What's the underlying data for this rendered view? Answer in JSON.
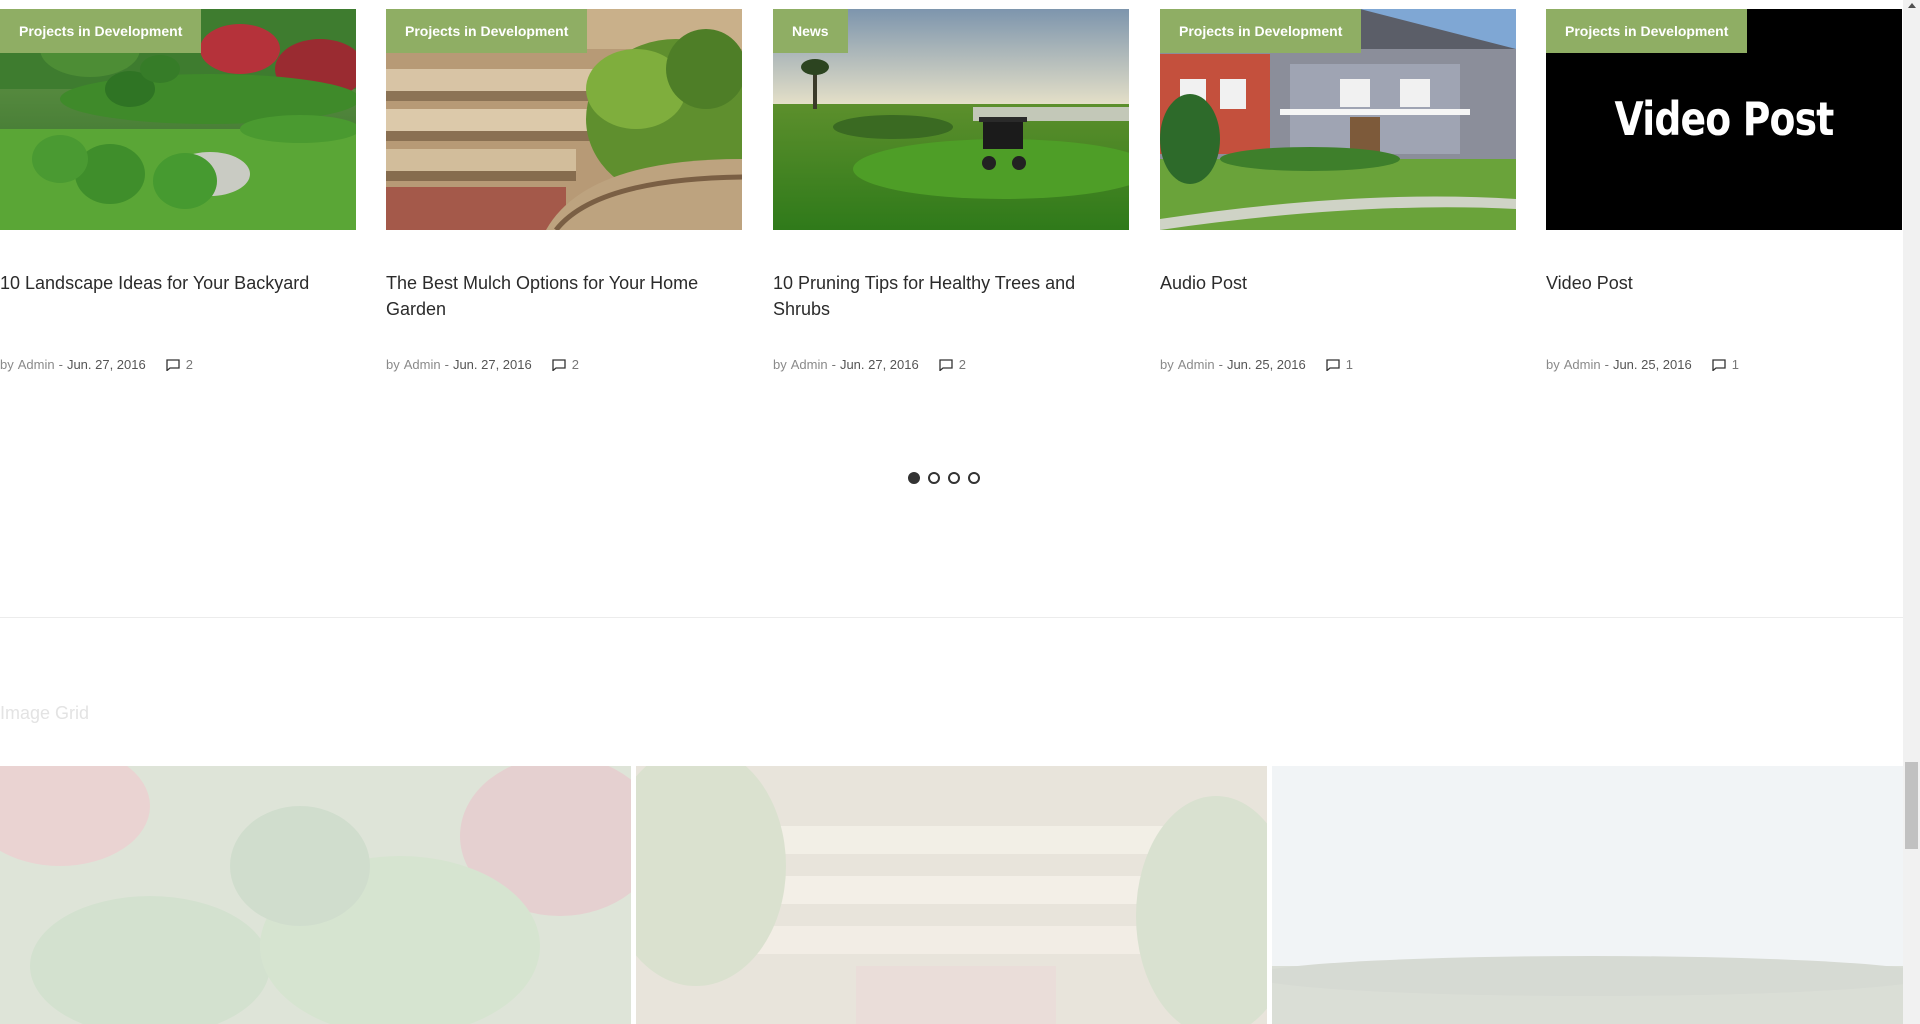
{
  "posts": [
    {
      "category": "Projects in Development",
      "title": "10 Landscape Ideas for Your Backyard",
      "by": "by",
      "author": "Admin",
      "separator": "-",
      "date": "Jun. 27, 2016",
      "comments": "2"
    },
    {
      "category": "Projects in Development",
      "title": "The Best Mulch Options for Your Home Garden",
      "by": "by",
      "author": "Admin",
      "separator": "-",
      "date": "Jun. 27, 2016",
      "comments": "2"
    },
    {
      "category": "News",
      "title": "10 Pruning Tips for Healthy Trees and Shrubs",
      "by": "by",
      "author": "Admin",
      "separator": "-",
      "date": "Jun. 27, 2016",
      "comments": "2"
    },
    {
      "category": "Projects in Development",
      "title": "Audio Post",
      "by": "by",
      "author": "Admin",
      "separator": "-",
      "date": "Jun. 25, 2016",
      "comments": "1"
    },
    {
      "category": "Projects in Development",
      "title": "Video Post",
      "by": "by",
      "author": "Admin",
      "separator": "-",
      "date": "Jun. 25, 2016",
      "comments": "1",
      "thumb_text": "Video Post"
    }
  ],
  "pager": {
    "pages": 4,
    "active": 1
  },
  "image_grid": {
    "title": "Image Grid"
  },
  "colors": {
    "category_bg": "#8fae64",
    "title_text": "#2b2b2b",
    "meta_text": "#777777"
  },
  "icons": {
    "comment": "comment-bubble-icon"
  }
}
